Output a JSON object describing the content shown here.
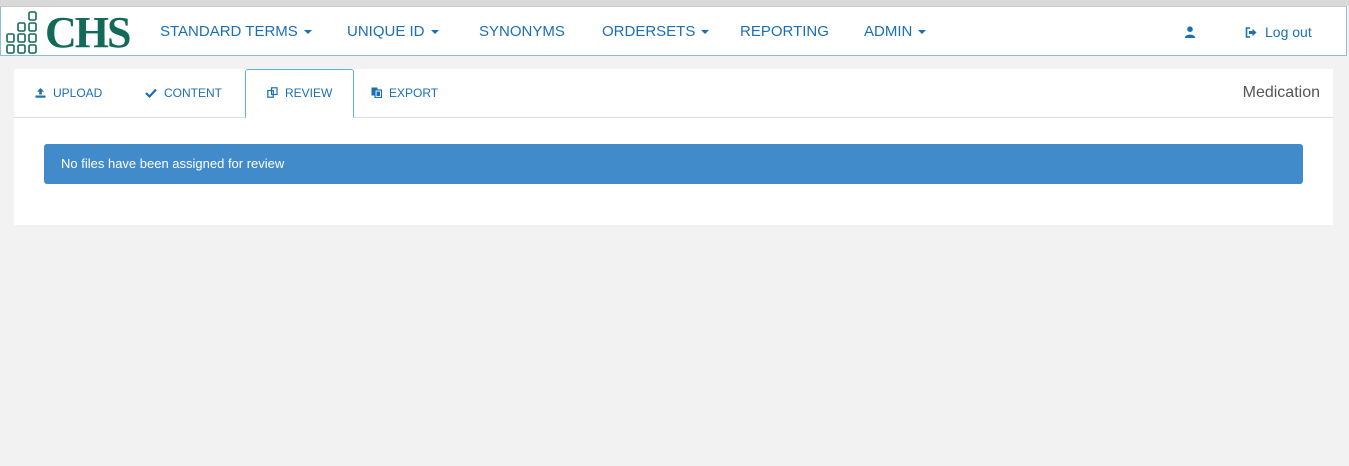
{
  "brand": {
    "logo_text": "CHS"
  },
  "nav": {
    "items": [
      {
        "label": "STANDARD TERMS",
        "dropdown": true
      },
      {
        "label": "UNIQUE ID",
        "dropdown": true
      },
      {
        "label": "SYNONYMS",
        "dropdown": false
      },
      {
        "label": "ORDERSETS",
        "dropdown": true
      },
      {
        "label": "REPORTING",
        "dropdown": false
      },
      {
        "label": "ADMIN",
        "dropdown": true
      }
    ],
    "user_icon": "user-icon",
    "logout_label": "Log out",
    "logout_icon": "sign-out-icon"
  },
  "tabs": {
    "items": [
      {
        "label": "UPLOAD",
        "icon": "upload-icon",
        "active": false
      },
      {
        "label": "CONTENT",
        "icon": "check-icon",
        "active": false
      },
      {
        "label": "REVIEW",
        "icon": "copy-icon",
        "active": true
      },
      {
        "label": "EXPORT",
        "icon": "export-icon",
        "active": false
      }
    ],
    "panel_title": "Medication"
  },
  "alert": {
    "message": "No files have been assigned for review"
  },
  "colors": {
    "brand_green": "#136a58",
    "link_blue": "#1a6fb5",
    "alert_blue": "#428bca",
    "active_tab_border": "#5bb5d6",
    "page_bg": "#f2f2f2"
  }
}
